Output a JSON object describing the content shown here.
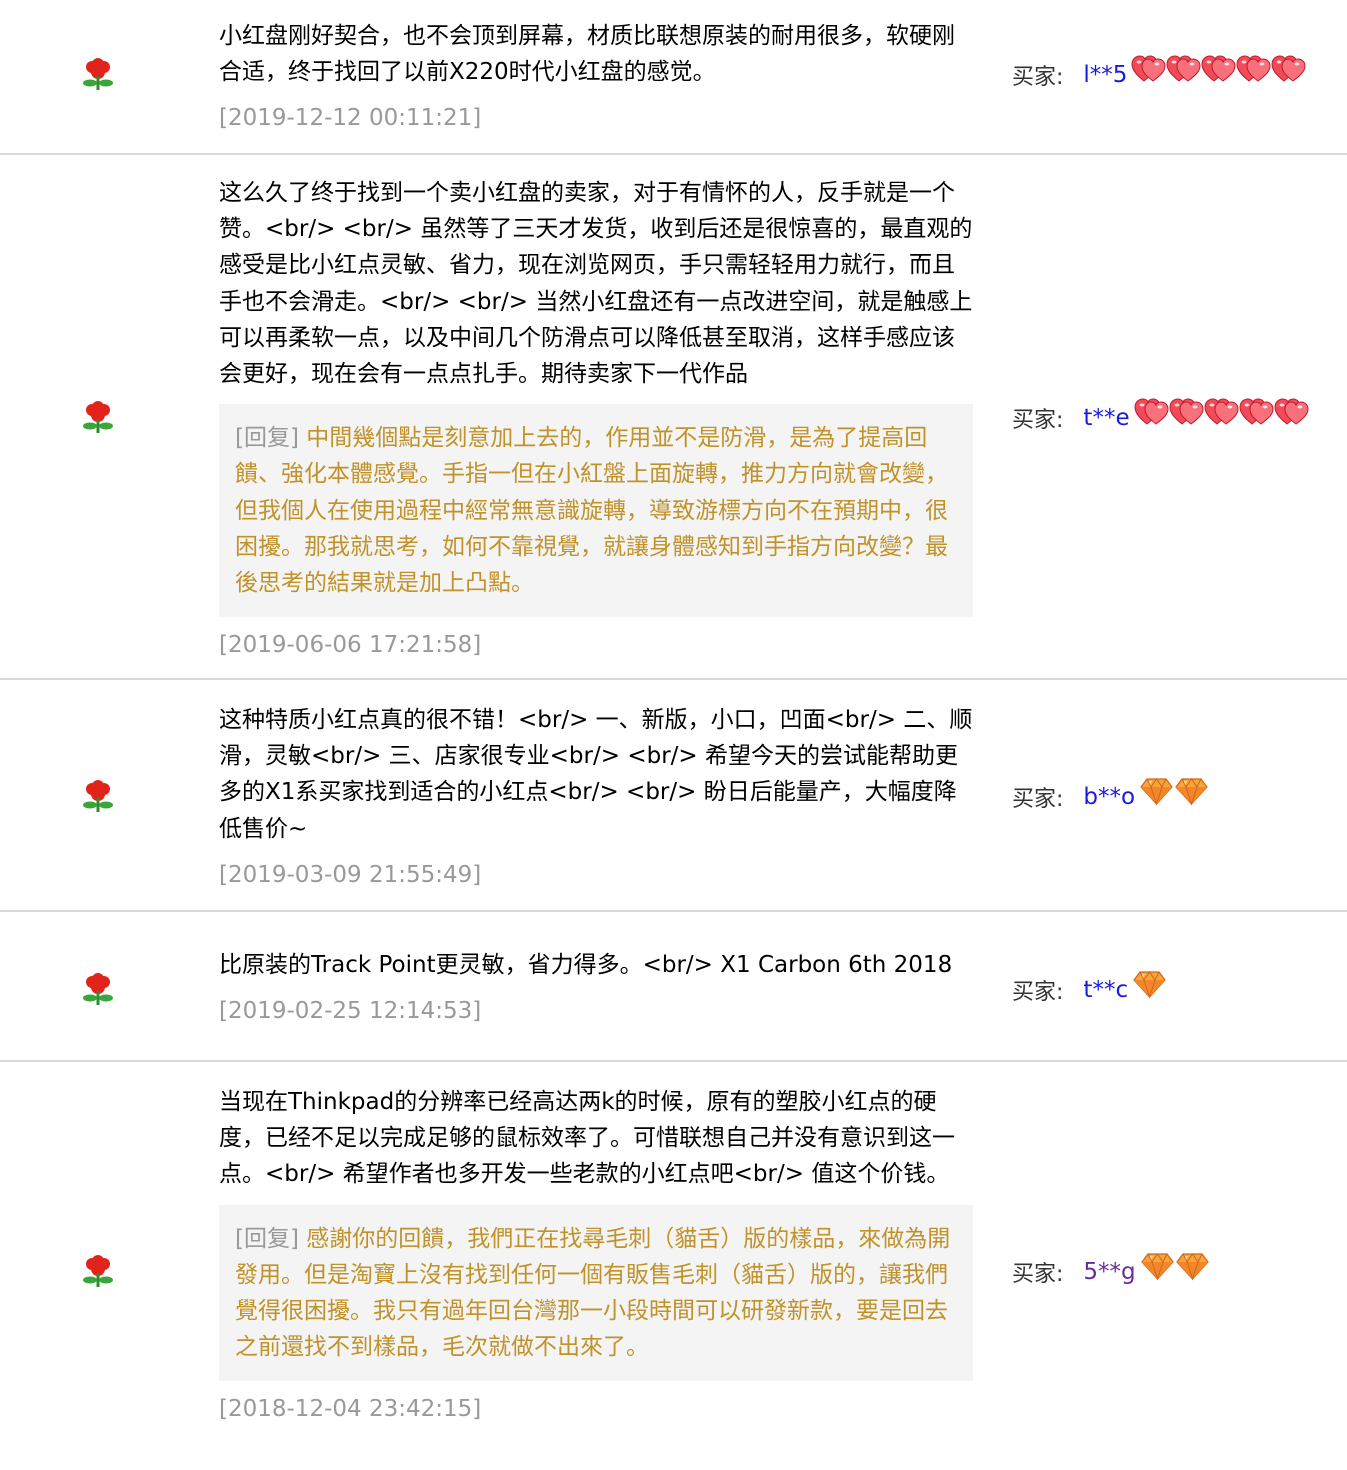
{
  "reviews": [
    {
      "text": "小红盘刚好契合，也不会顶到屏幕，材质比联想原装的耐用很多，软硬刚合适，终于找回了以前X220时代小红盘的感觉。",
      "date": "[2019-12-12 00:11:21]",
      "buyer_label": "买家:",
      "buyer_name": "l**5",
      "buyer_name_color": "#1a1adf",
      "badge_icon": "red-heart-icon",
      "badge_count": 5
    },
    {
      "text": "这么久了终于找到一个卖小红盘的卖家，对于有情怀的人，反手就是一个赞。<br/> <br/> 虽然等了三天才发货，收到后还是很惊喜的，最直观的感受是比小红点灵敏、省力，现在浏览网页，手只需轻轻用力就行，而且手也不会滑走。<br/> <br/> 当然小红盘还有一点改进空间，就是触感上可以再柔软一点，以及中间几个防滑点可以降低甚至取消，这样手感应该会更好，现在会有一点点扎手。期待卖家下一代作品",
      "reply_tag": "[回复]",
      "reply": "中間幾個點是刻意加上去的，作用並不是防滑，是為了提高回饋、強化本體感覺。手指一但在小紅盤上面旋轉，推力方向就會改變，但我個人在使用過程中經常無意識旋轉，導致游標方向不在預期中，很困擾。那我就思考，如何不靠視覺，就讓身體感知到手指方向改變？最後思考的結果就是加上凸點。",
      "date": "[2019-06-06 17:21:58]",
      "buyer_label": "买家:",
      "buyer_name": "t**e",
      "buyer_name_color": "#1a1adf",
      "badge_icon": "red-heart-icon",
      "badge_count": 5
    },
    {
      "text": "这种特质小红点真的很不错！<br/> 一、新版，小口，凹面<br/> 二、顺滑，灵敏<br/> 三、店家很专业<br/> <br/> 希望今天的尝试能帮助更多的X1系买家找到适合的小红点<br/> <br/> 盼日后能量产，大幅度降低售价~",
      "date": "[2019-03-09 21:55:49]",
      "buyer_label": "买家:",
      "buyer_name": "b**o",
      "buyer_name_color": "#1a1adf",
      "badge_icon": "diamond-icon",
      "badge_count": 2
    },
    {
      "text": "比原装的Track Point更灵敏，省力得多。<br/> X1 Carbon 6th 2018",
      "date": "[2019-02-25 12:14:53]",
      "buyer_label": "买家:",
      "buyer_name": "t**c",
      "buyer_name_color": "#1a1adf",
      "badge_icon": "diamond-icon",
      "badge_count": 1
    },
    {
      "text": "当现在Thinkpad的分辨率已经高达两k的时候，原有的塑胶小红点的硬度，已经不足以完成足够的鼠标效率了。可惜联想自己并没有意识到这一点。<br/> 希望作者也多开发一些老款的小红点吧<br/> 值这个价钱。",
      "reply_tag": "[回复]",
      "reply": "感謝你的回饋，我們正在找尋毛刺（貓舌）版的樣品，來做為開發用。但是淘寶上沒有找到任何一個有販售毛刺（貓舌）版的，讓我們覺得很困擾。我只有過年回台灣那一小段時間可以研發新款，要是回去之前還找不到樣品，毛次就做不出來了。",
      "date": "[2018-12-04 23:42:15]",
      "buyer_label": "买家:",
      "buyer_name": "5**g",
      "buyer_name_color": "#6a2c9a",
      "badge_icon": "diamond-icon",
      "badge_count": 2
    }
  ]
}
